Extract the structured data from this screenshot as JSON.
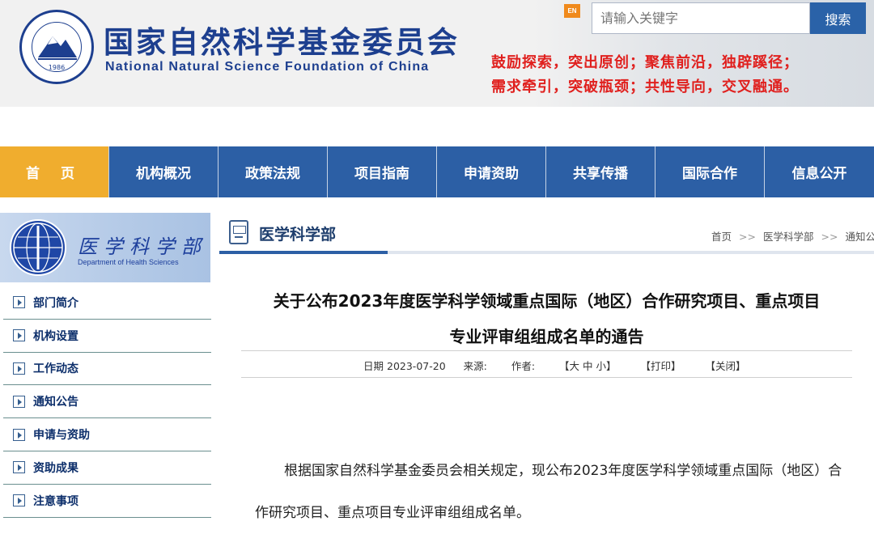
{
  "header": {
    "org_name_cn": "国家自然科学基金委员会",
    "org_name_en": "National Natural Science Foundation of China",
    "logo_year": "1986",
    "en_badge": "EN",
    "search_placeholder": "请输入关键字",
    "search_button": "搜索",
    "slogan_line1": "鼓励探索，突出原创；聚焦前沿，独辟蹊径；",
    "slogan_line2": "需求牵引，突破瓶颈；共性导向，交叉融通。"
  },
  "nav": {
    "items": [
      "首 页",
      "机构概况",
      "政策法规",
      "项目指南",
      "申请资助",
      "共享传播",
      "国际合作",
      "信息公开"
    ],
    "active_index": 0
  },
  "sidebar": {
    "banner_cn": "医学科学部",
    "banner_en": "Department of Health Sciences",
    "items": [
      "部门简介",
      "机构设置",
      "工作动态",
      "通知公告",
      "申请与资助",
      "资助成果",
      "注意事项"
    ]
  },
  "section": {
    "title": "医学科学部",
    "breadcrumb": [
      "首页",
      "医学科学部",
      "通知公告"
    ],
    "breadcrumb_sep": ">>"
  },
  "article": {
    "title_line1": "关于公布2023年度医学科学领域重点国际（地区）合作研究项目、重点项目",
    "title_line2": "专业评审组组成名单的通告",
    "date_label": "日期",
    "date": "2023-07-20",
    "source_label": "来源:",
    "author_label": "作者:",
    "font_size_ctrl": "【大 中 小】",
    "print_ctrl": "【打印】",
    "close_ctrl": "【关闭】",
    "body_p1": "根据国家自然科学基金委员会相关规定，现公布2023年度医学科学领域重点国际（地区）合作研究项目、重点项目专业评审组组成名单。"
  },
  "colors": {
    "brand_blue": "#2c5fa5",
    "nav_active": "#f0ad2e",
    "slogan_red": "#e0201e",
    "en_badge": "#f08a1c"
  }
}
